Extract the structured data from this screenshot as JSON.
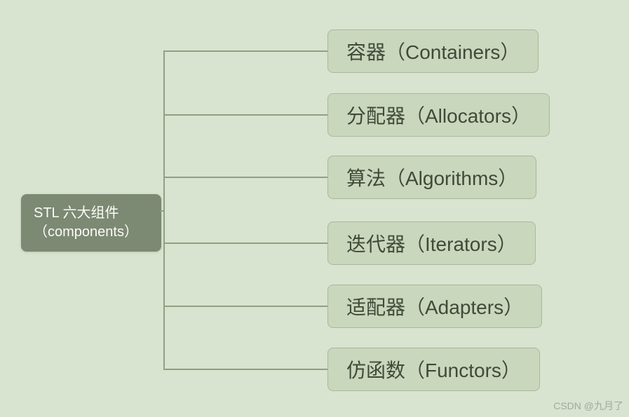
{
  "root": {
    "label": "STL 六大组件（components）"
  },
  "children": [
    {
      "label": "容器（Containers）"
    },
    {
      "label": "分配器（Allocators）"
    },
    {
      "label": "算法（Algorithms）"
    },
    {
      "label": "迭代器（Iterators）"
    },
    {
      "label": "适配器（Adapters）"
    },
    {
      "label": "仿函数（Functors）"
    }
  ],
  "watermark": "CSDN @九月了"
}
